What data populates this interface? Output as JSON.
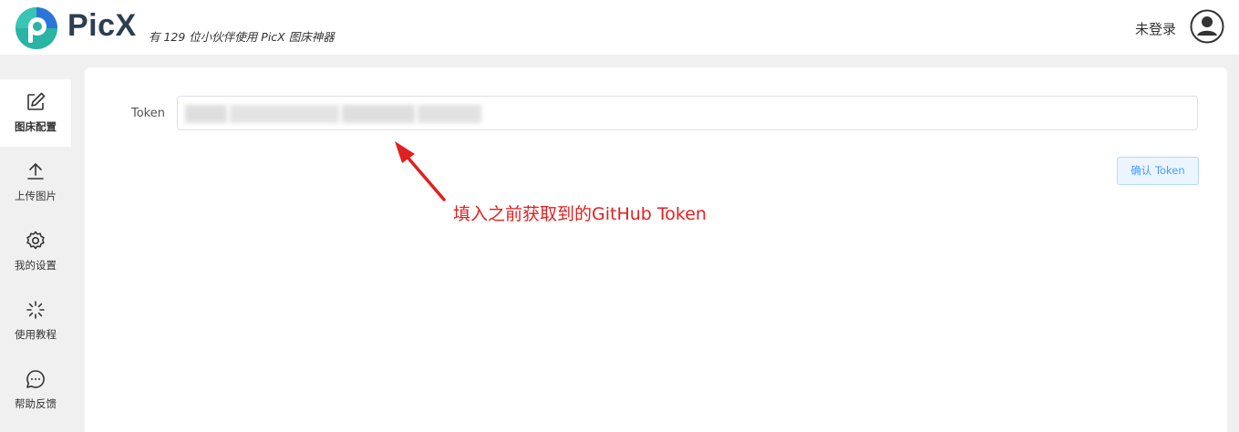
{
  "header": {
    "app_name": "PicX",
    "tagline": "有 129 位小伙伴使用 PicX 图床神器",
    "login_status": "未登录"
  },
  "sidebar": {
    "items": [
      {
        "label": "图床配置",
        "icon": "edit-icon",
        "active": true
      },
      {
        "label": "上传图片",
        "icon": "upload-icon",
        "active": false
      },
      {
        "label": "我的设置",
        "icon": "gear-icon",
        "active": false
      },
      {
        "label": "使用教程",
        "icon": "sparkle-icon",
        "active": false
      },
      {
        "label": "帮助反馈",
        "icon": "chat-bubble-icon",
        "active": false
      }
    ]
  },
  "form": {
    "token_label": "Token",
    "confirm_button": "确认 Token"
  },
  "annotation": {
    "text": "填入之前获取到的GitHub Token"
  },
  "colors": {
    "brand_teal": "#2bb3a4",
    "brand_blue": "#2d74da",
    "annotation_red": "#e02020",
    "button_blue": "#409eff"
  }
}
